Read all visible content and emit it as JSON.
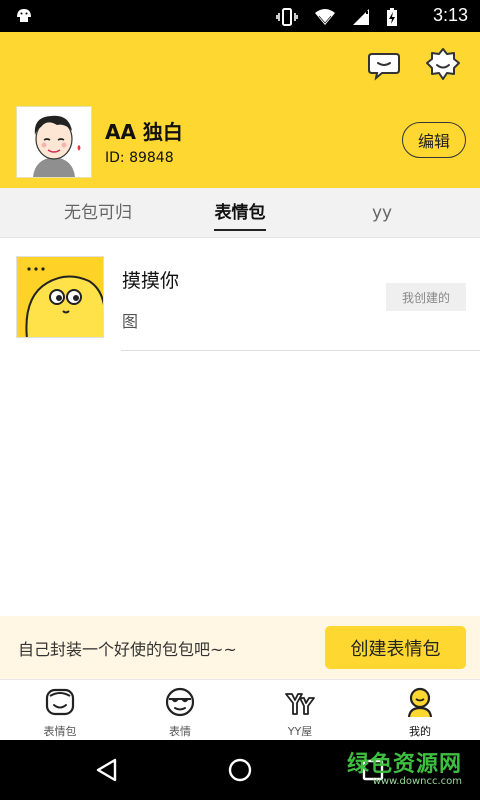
{
  "status_bar": {
    "time": "3:13"
  },
  "profile": {
    "name": "AA 独白",
    "id_text": "ID: 89848",
    "edit_label": "编辑"
  },
  "tabs": [
    {
      "label": "无包可归",
      "active": false
    },
    {
      "label": "表情包",
      "active": true
    },
    {
      "label": "yy",
      "active": false
    }
  ],
  "list": [
    {
      "title": "摸摸你",
      "subtitle": "图",
      "badge": "我创建的"
    }
  ],
  "promo": {
    "text": "自己封装一个好使的包包吧~~",
    "button_label": "创建表情包"
  },
  "bottom_nav": [
    {
      "label": "表情包",
      "icon": "smiley-box-icon",
      "active": false
    },
    {
      "label": "表情",
      "icon": "sunglasses-face-icon",
      "active": false
    },
    {
      "label": "YY屋",
      "icon": "yy-house-icon",
      "active": false
    },
    {
      "label": "我的",
      "icon": "person-icon",
      "active": true
    }
  ],
  "watermark": {
    "line1": "绿色资源网",
    "line2": "www.downcc.com"
  },
  "colors": {
    "accent": "#FED831",
    "promo_bg": "#FFF7E3"
  }
}
